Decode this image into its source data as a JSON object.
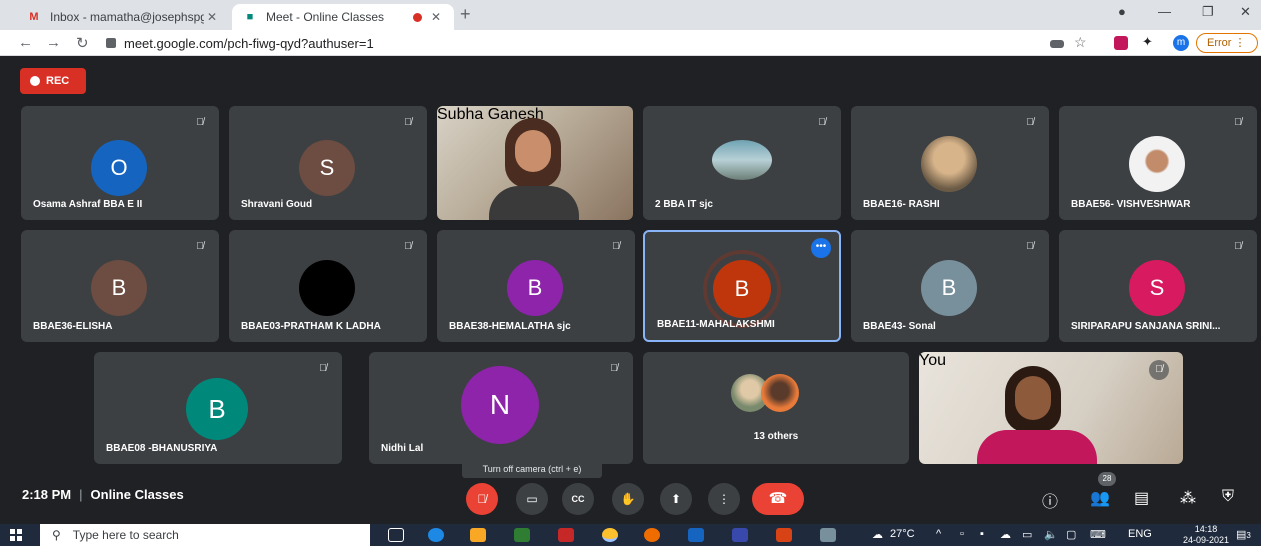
{
  "browser": {
    "tabs": [
      {
        "label": "Inbox - mamatha@josephspgcoll",
        "favicon": "M"
      },
      {
        "label": "Meet - Online Classes",
        "favicon": "■"
      }
    ],
    "url": "meet.google.com/pch-fiwg-qyd?authuser=1",
    "profile_initial": "m",
    "error_label": "Error"
  },
  "meet": {
    "rec_label": "REC",
    "participants": [
      {
        "name": "Osama Ashraf BBA E II",
        "initial": "O",
        "color": "#1565c0"
      },
      {
        "name": "Shravani Goud",
        "initial": "S",
        "color": "#6d4c41"
      },
      {
        "name": "Subha Ganesh",
        "initial": "",
        "color": ""
      },
      {
        "name": "2 BBA IT sjc",
        "initial": "",
        "color": ""
      },
      {
        "name": "BBAE16- RASHI",
        "initial": "",
        "color": ""
      },
      {
        "name": "BBAE56- VISHVESHWAR",
        "initial": "",
        "color": ""
      },
      {
        "name": "BBAE36-ELISHA",
        "initial": "B",
        "color": "#6d4c41"
      },
      {
        "name": "BBAE03-PRATHAM K LADHA",
        "initial": "",
        "color": "#000000"
      },
      {
        "name": "BBAE38-HEMALATHA sjc",
        "initial": "B",
        "color": "#8e24aa"
      },
      {
        "name": "BBAE11-MAHALAKSHMI",
        "initial": "B",
        "color": "#bf360c"
      },
      {
        "name": "BBAE43- Sonal",
        "initial": "B",
        "color": "#78909c"
      },
      {
        "name": "SIRIPARAPU SANJANA SRINI...",
        "initial": "S",
        "color": "#d81b60"
      },
      {
        "name": "BBAE08 -BHANUSRIYA",
        "initial": "B",
        "color": "#00897b"
      },
      {
        "name": "Nidhi Lal",
        "initial": "N",
        "color": "#8e24aa"
      },
      {
        "name": "13 others",
        "initial": "",
        "color": ""
      },
      {
        "name": "You",
        "initial": "",
        "color": ""
      }
    ],
    "tooltip": "Turn off camera (ctrl + e)",
    "time": "2:18 PM",
    "meeting_title": "Online Classes",
    "people_count": "28"
  },
  "taskbar": {
    "search_placeholder": "Type here to search",
    "temperature": "27°C",
    "language": "ENG",
    "time": "14:18",
    "date": "24-09-2021",
    "notification_count": "3"
  }
}
